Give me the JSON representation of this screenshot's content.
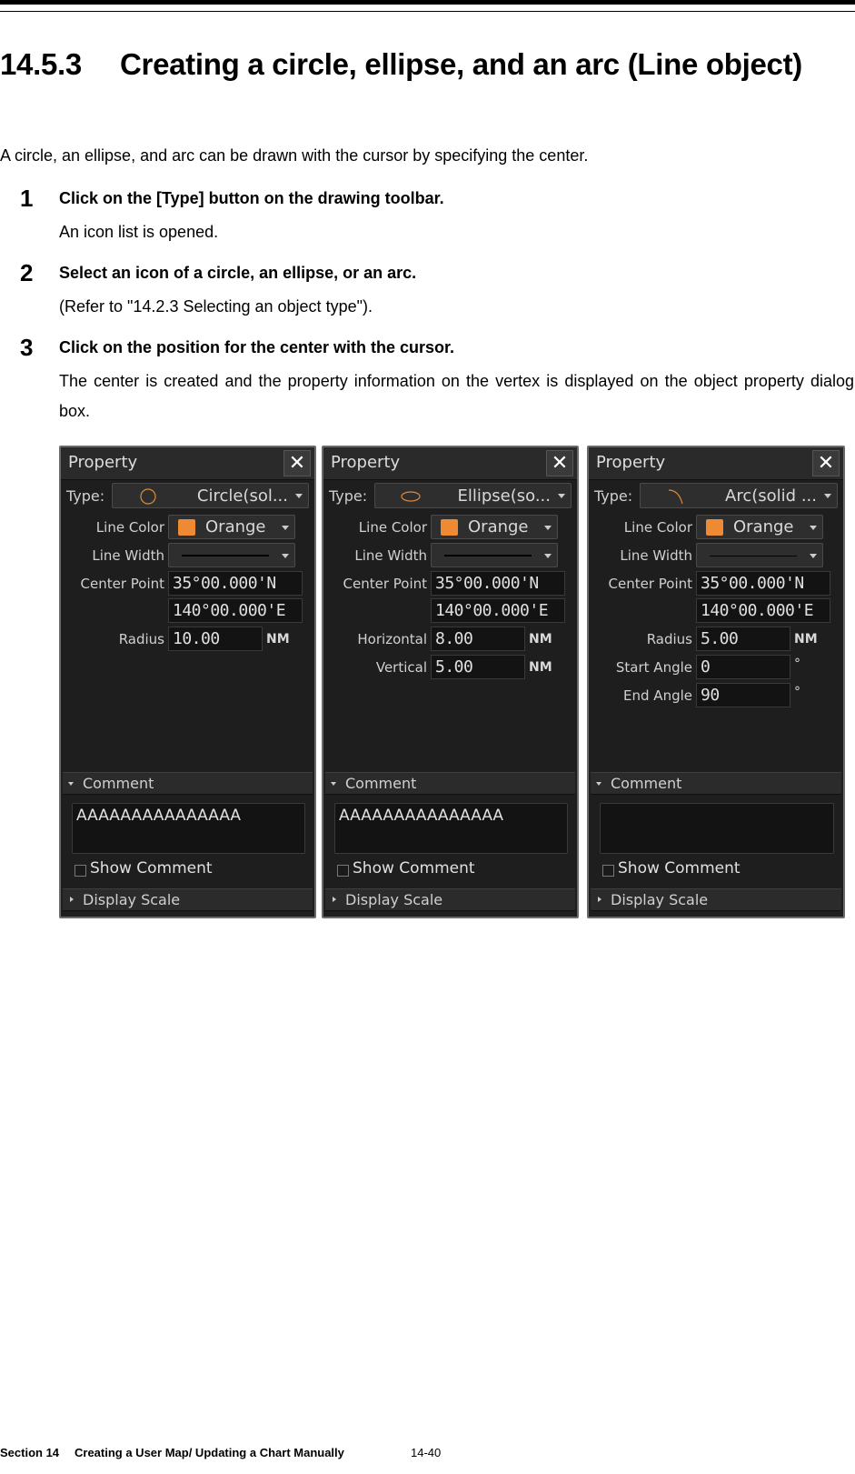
{
  "heading": {
    "number": "14.5.3",
    "title": "Creating a circle, ellipse, and an arc (Line object)"
  },
  "intro": "A circle, an ellipse, and arc can be drawn with the cursor by specifying the center.",
  "steps": [
    {
      "number": "1",
      "title": "Click on the [Type] button on the drawing toolbar.",
      "desc": "An icon list is opened."
    },
    {
      "number": "2",
      "title": "Select an icon of a circle, an ellipse, or an arc.",
      "desc": "(Refer to \"14.2.3 Selecting an object type\")."
    },
    {
      "number": "3",
      "title": "Click on the position for the center with the cursor.",
      "desc": "The center is created and the property information on the vertex is displayed on the object property dialog box."
    }
  ],
  "panels": [
    {
      "title": "Property",
      "close_icon": "close-icon",
      "type_label": "Type:",
      "type_icon": "circle-icon",
      "type_value": "Circle(sol...",
      "line_color_label": "Line Color",
      "line_color_value": "Orange",
      "line_color_hex": "#ef8a34",
      "line_width_label": "Line Width",
      "center_label": "Center Point",
      "center_lat": "35°00.000'N",
      "center_lon": "140°00.000'E",
      "fields": [
        {
          "label": "Radius",
          "value": "10.00",
          "unit": "NM"
        }
      ],
      "comment_label": "Comment",
      "comment_value": "AAAAAAAAAAAAAAA",
      "show_comment_label": "Show Comment",
      "show_comment_checked": false,
      "display_scale_label": "Display Scale"
    },
    {
      "title": "Property",
      "close_icon": "close-icon",
      "type_label": "Type:",
      "type_icon": "ellipse-icon",
      "type_value": "Ellipse(so...",
      "line_color_label": "Line Color",
      "line_color_value": "Orange",
      "line_color_hex": "#ef8a34",
      "line_width_label": "Line Width",
      "center_label": "Center Point",
      "center_lat": "35°00.000'N",
      "center_lon": "140°00.000'E",
      "fields": [
        {
          "label": "Horizontal",
          "value": "8.00",
          "unit": "NM"
        },
        {
          "label": "Vertical",
          "value": "5.00",
          "unit": "NM"
        }
      ],
      "comment_label": "Comment",
      "comment_value": "AAAAAAAAAAAAAAA",
      "show_comment_label": "Show Comment",
      "show_comment_checked": false,
      "display_scale_label": "Display Scale"
    },
    {
      "title": "Property",
      "close_icon": "close-icon",
      "type_label": "Type:",
      "type_icon": "arc-icon",
      "type_value": "Arc(solid ...",
      "line_color_label": "Line Color",
      "line_color_value": "Orange",
      "line_color_hex": "#ef8a34",
      "line_width_label": "Line Width",
      "center_label": "Center Point",
      "center_lat": "35°00.000'N",
      "center_lon": "140°00.000'E",
      "fields": [
        {
          "label": "Radius",
          "value": "5.00",
          "unit": "NM"
        },
        {
          "label": "Start Angle",
          "value": "0",
          "unit": "°"
        },
        {
          "label": "End Angle",
          "value": "90",
          "unit": "°"
        }
      ],
      "comment_label": "Comment",
      "comment_value": "",
      "show_comment_label": "Show Comment",
      "show_comment_checked": false,
      "display_scale_label": "Display Scale"
    }
  ],
  "footer": {
    "section": "Section 14",
    "chapter": "Creating a User Map/ Updating a Chart Manually",
    "page": "14-40"
  }
}
